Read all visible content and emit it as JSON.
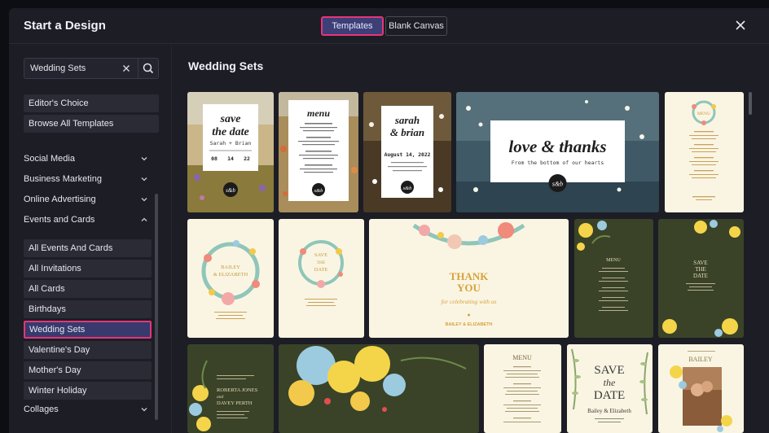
{
  "modal": {
    "title": "Start a Design",
    "tabs": [
      {
        "label": "Templates",
        "active": true
      },
      {
        "label": "Blank Canvas",
        "active": false
      }
    ]
  },
  "sidebar": {
    "search": {
      "value": "Wedding Sets",
      "placeholder": ""
    },
    "quick_links": [
      "Editor's Choice",
      "Browse All Templates"
    ],
    "categories": [
      {
        "label": "Social Media",
        "expanded": false
      },
      {
        "label": "Business Marketing",
        "expanded": false
      },
      {
        "label": "Online Advertising",
        "expanded": false
      },
      {
        "label": "Events and Cards",
        "expanded": true
      }
    ],
    "subcategories": [
      {
        "label": "All Events And Cards"
      },
      {
        "label": "All Invitations"
      },
      {
        "label": "All Cards"
      },
      {
        "label": "Birthdays"
      },
      {
        "label": "Wedding Sets",
        "active": true
      },
      {
        "label": "Valentine's Day"
      },
      {
        "label": "Mother's Day"
      },
      {
        "label": "Winter Holiday"
      }
    ],
    "collapsed_category": {
      "label": "Collages"
    }
  },
  "main": {
    "section_title": "Wedding Sets",
    "templates": {
      "save_date_1": {
        "title1": "save",
        "title2": "the date",
        "names": "Sarah + Brian",
        "d1": "08",
        "d2": "14",
        "d3": "22",
        "badge": "s&b"
      },
      "menu_1": {
        "title": "menu",
        "badge": "s&b"
      },
      "sarah_brian": {
        "title1": "sarah",
        "title2": "& brian",
        "date": "August 14, 2022",
        "badge": "s&b"
      },
      "love_thanks": {
        "title": "love & thanks",
        "subtitle": "From the bottom of our hearts",
        "badge": "s&b"
      },
      "menu_2": {
        "title": "MENU"
      },
      "bailey_wreath": {
        "line1": "BAILEY",
        "line2": "& ELIZABETH"
      },
      "save_date_2": {
        "line1": "SAVE",
        "line2": "THE",
        "line3": "DATE"
      },
      "thank_you": {
        "line1": "THANK",
        "line2": "YOU",
        "line3": "for celebrating with us",
        "line4": "BAILEY & ELIZABETH"
      },
      "menu_3": {
        "title": "MENU"
      },
      "save_date_3": {
        "line1": "SAVE",
        "line2": "THE",
        "line3": "DATE"
      },
      "roberta": {
        "line1": "ROBERTA JONES",
        "line2": "and",
        "line3": "DAVEY PERTH"
      },
      "menu_4": {
        "title": "MENU"
      },
      "save_date_4": {
        "line1": "SAVE",
        "line2": "the",
        "line3": "DATE",
        "names": "Bailey & Elizabeth"
      },
      "bailey_photo": {
        "line1": "BAILEY"
      }
    }
  },
  "colors": {
    "accent_pink": "#e63577",
    "active_tab_bg": "#3e3f77",
    "modal_bg": "#1c1d25",
    "cream": "#faf5e3",
    "olive": "#3a4328",
    "gold": "#d7a23b"
  }
}
